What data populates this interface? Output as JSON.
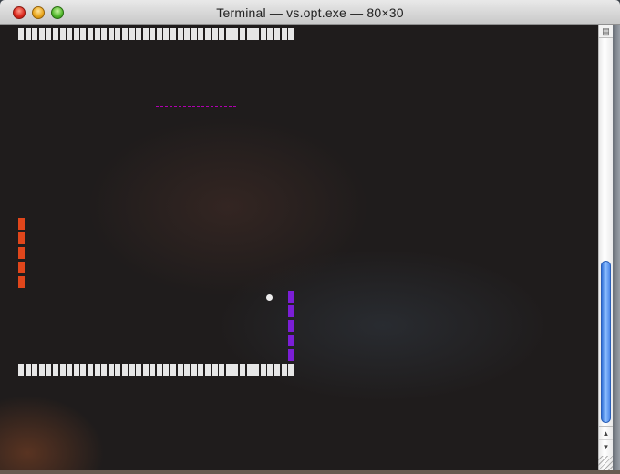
{
  "window": {
    "title": "Terminal — vs.opt.exe — 80×30"
  },
  "game": {
    "top_wall_cells": 40,
    "bottom_wall_cells": 40,
    "left_paddle_segments": 5,
    "right_paddle_segments": 5,
    "colors": {
      "wall": "#e6e6e6",
      "left_paddle": "#e0461b",
      "right_paddle": "#7b1ed6",
      "ball": "#ececec",
      "divider": "#b000b0"
    }
  },
  "icons": {
    "split": "split-pane-icon",
    "scroll_up": "scroll-up-arrow-icon",
    "scroll_down": "scroll-down-arrow-icon",
    "resize": "resize-grip-icon"
  },
  "scrollbar": {
    "up_glyph": "▲",
    "down_glyph": "▼",
    "split_glyph": "▤"
  }
}
